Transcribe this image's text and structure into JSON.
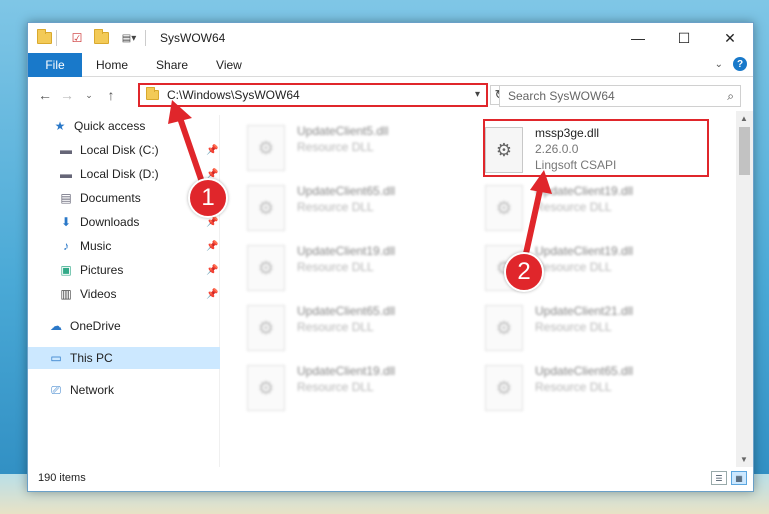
{
  "window": {
    "title": "SysWOW64"
  },
  "title_controls": {
    "minimize": "—",
    "maximize": "☐",
    "close": "✕"
  },
  "ribbon": {
    "tabs": [
      "File",
      "Home",
      "Share",
      "View"
    ]
  },
  "address_bar": {
    "path": "C:\\Windows\\SysWOW64"
  },
  "search": {
    "placeholder": "Search SysWOW64"
  },
  "sidebar": {
    "items": [
      {
        "label": "Quick access",
        "icon": "star-icon"
      },
      {
        "label": "Local Disk (C:)",
        "icon": "drive-icon",
        "pinned": true
      },
      {
        "label": "Local Disk (D:)",
        "icon": "drive-icon",
        "pinned": true
      },
      {
        "label": "Documents",
        "icon": "documents-icon",
        "pinned": true
      },
      {
        "label": "Downloads",
        "icon": "downloads-icon",
        "pinned": true
      },
      {
        "label": "Music",
        "icon": "music-icon",
        "pinned": true
      },
      {
        "label": "Pictures",
        "icon": "pictures-icon",
        "pinned": true
      },
      {
        "label": "Videos",
        "icon": "videos-icon",
        "pinned": true
      },
      {
        "label": "OneDrive",
        "icon": "onedrive-icon"
      },
      {
        "label": "This PC",
        "icon": "pc-icon",
        "selected": true
      },
      {
        "label": "Network",
        "icon": "network-icon"
      }
    ]
  },
  "files": {
    "left": [
      {
        "name": "UpdateClient5.dll",
        "type": "Resource DLL"
      },
      {
        "name": "UpdateClient65.dll",
        "type": "Resource DLL"
      },
      {
        "name": "UpdateClient19.dll",
        "type": "Resource DLL"
      },
      {
        "name": "UpdateClient65.dll",
        "type": "Resource DLL"
      },
      {
        "name": "UpdateClient19.dll",
        "type": "Resource DLL"
      }
    ],
    "right_highlight": {
      "name": "mssp3ge.dll",
      "version": "2.26.0.0",
      "company": "Lingsoft CSAPI"
    },
    "right": [
      {
        "name": "UpdateClient19.dll",
        "type": "Resource DLL"
      },
      {
        "name": "UpdateClient19.dll",
        "type": "Resource DLL"
      },
      {
        "name": "UpdateClient21.dll",
        "type": "Resource DLL"
      },
      {
        "name": "UpdateClient65.dll",
        "type": "Resource DLL"
      }
    ]
  },
  "status": {
    "count": "190 items"
  },
  "annotations": {
    "badge1": "1",
    "badge2": "2"
  },
  "colors": {
    "accent": "#1979ca",
    "highlight": "#e0262b",
    "selection": "#cce8ff"
  }
}
